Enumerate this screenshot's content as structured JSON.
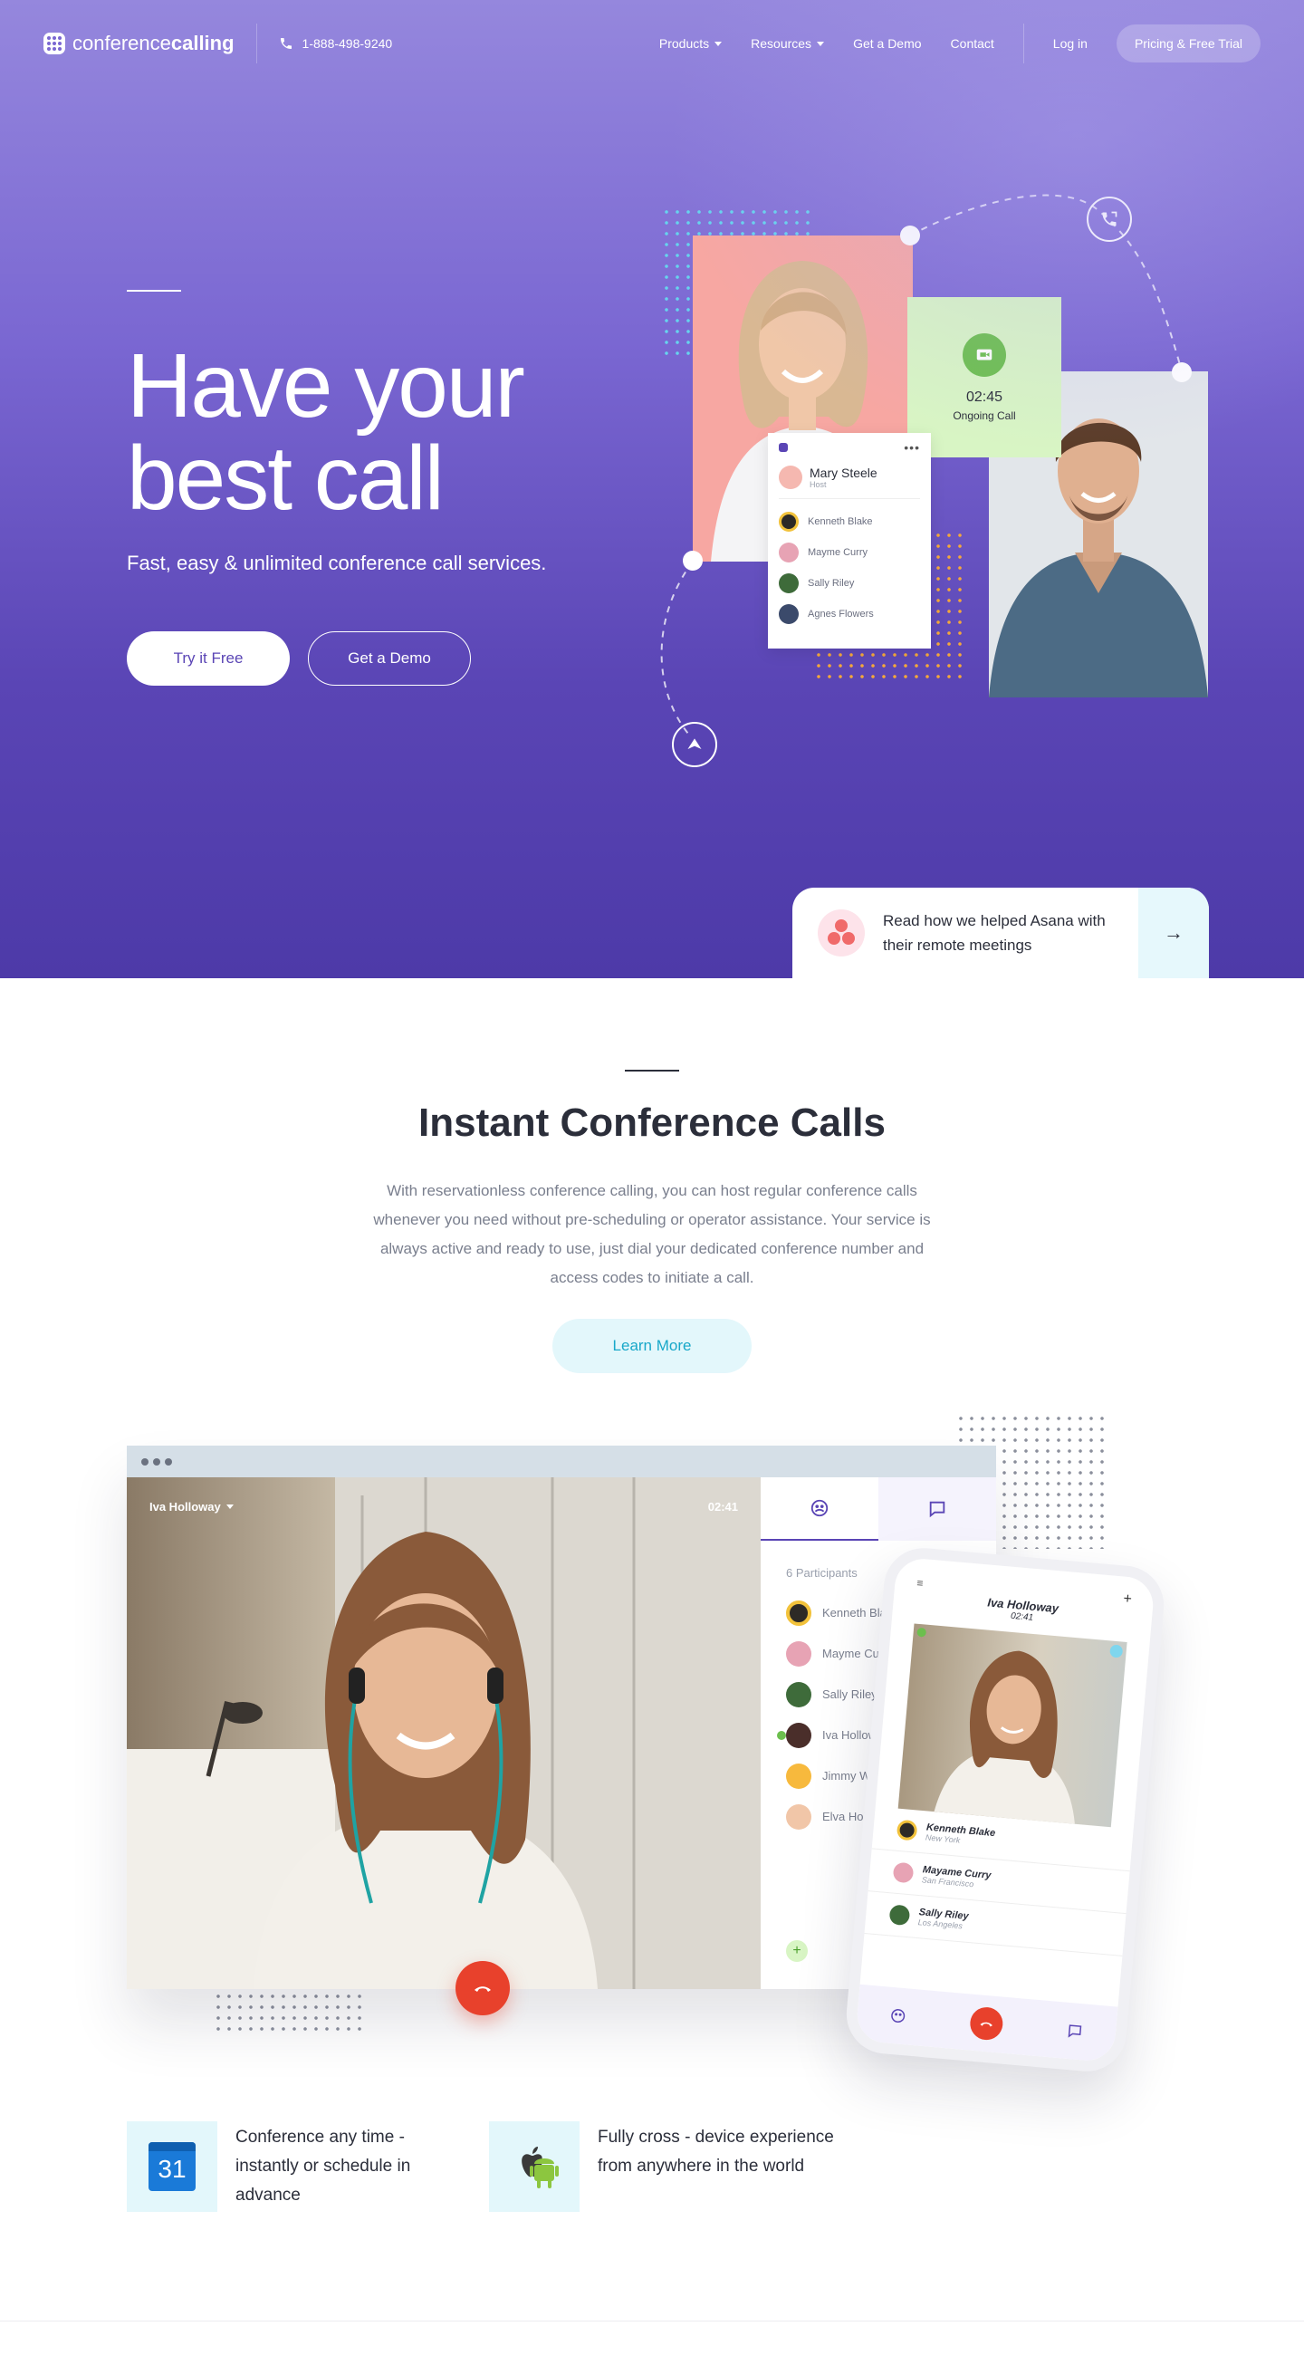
{
  "nav": {
    "logo_light": "conference",
    "logo_bold": "calling",
    "phone": "1-888-498-9240",
    "links": [
      "Products",
      "Resources",
      "Get a Demo",
      "Contact"
    ],
    "login": "Log in",
    "cta": "Pricing & Free Trial"
  },
  "hero": {
    "title_line1": "Have your",
    "title_line2": "best call",
    "subtitle": "Fast, easy & unlimited conference call services.",
    "primary_button": "Try it Free",
    "secondary_button": "Get a Demo",
    "call_card": {
      "time": "02:45",
      "label": "Ongoing Call"
    },
    "list_card": {
      "host_name": "Mary Steele",
      "host_role": "Host",
      "participants": [
        "Kenneth Blake",
        "Mayme Curry",
        "Sally Riley",
        "Agnes Flowers"
      ]
    },
    "promo": {
      "text": "Read how we helped Asana with their remote meetings",
      "arrow": "→"
    }
  },
  "section": {
    "title": "Instant Conference Calls",
    "body": "With reservationless conference calling, you can host regular conference calls whenever you need without pre-scheduling or operator assistance. Your service is always active and ready to use, just dial your dedicated conference number and access codes to initiate a call.",
    "button": "Learn More"
  },
  "app_window": {
    "speaker_name": "Iva Holloway",
    "call_time": "02:41",
    "participants_label": "6 Participants",
    "participants": [
      "Kenneth Blake",
      "Mayme Curry",
      "Sally Riley",
      "Iva Holloway",
      "Jimmy Warner",
      "Elva Holt"
    ],
    "add_label": "+"
  },
  "phone_app": {
    "name": "Iva Holloway",
    "time": "02:41",
    "contacts": [
      {
        "name": "Kenneth Blake",
        "city": "New York"
      },
      {
        "name": "Mayame Curry",
        "city": "San Francisco"
      },
      {
        "name": "Sally Riley",
        "city": "Los Angeles"
      }
    ]
  },
  "features": [
    {
      "icon": "calendar-icon",
      "calendar_day": "31",
      "text": "Conference any time - instantly or schedule in advance"
    },
    {
      "icon": "apple-android-icon",
      "text": "Fully cross - device experience from anywhere in the world"
    }
  ],
  "colors": {
    "hero_top": "#9587dd",
    "hero_bottom": "#4d3aa8",
    "accent_purple": "#5a45b5",
    "accent_cyan": "#18a8c9",
    "hangup_red": "#e8412c",
    "call_green": "#6cbf4e"
  }
}
